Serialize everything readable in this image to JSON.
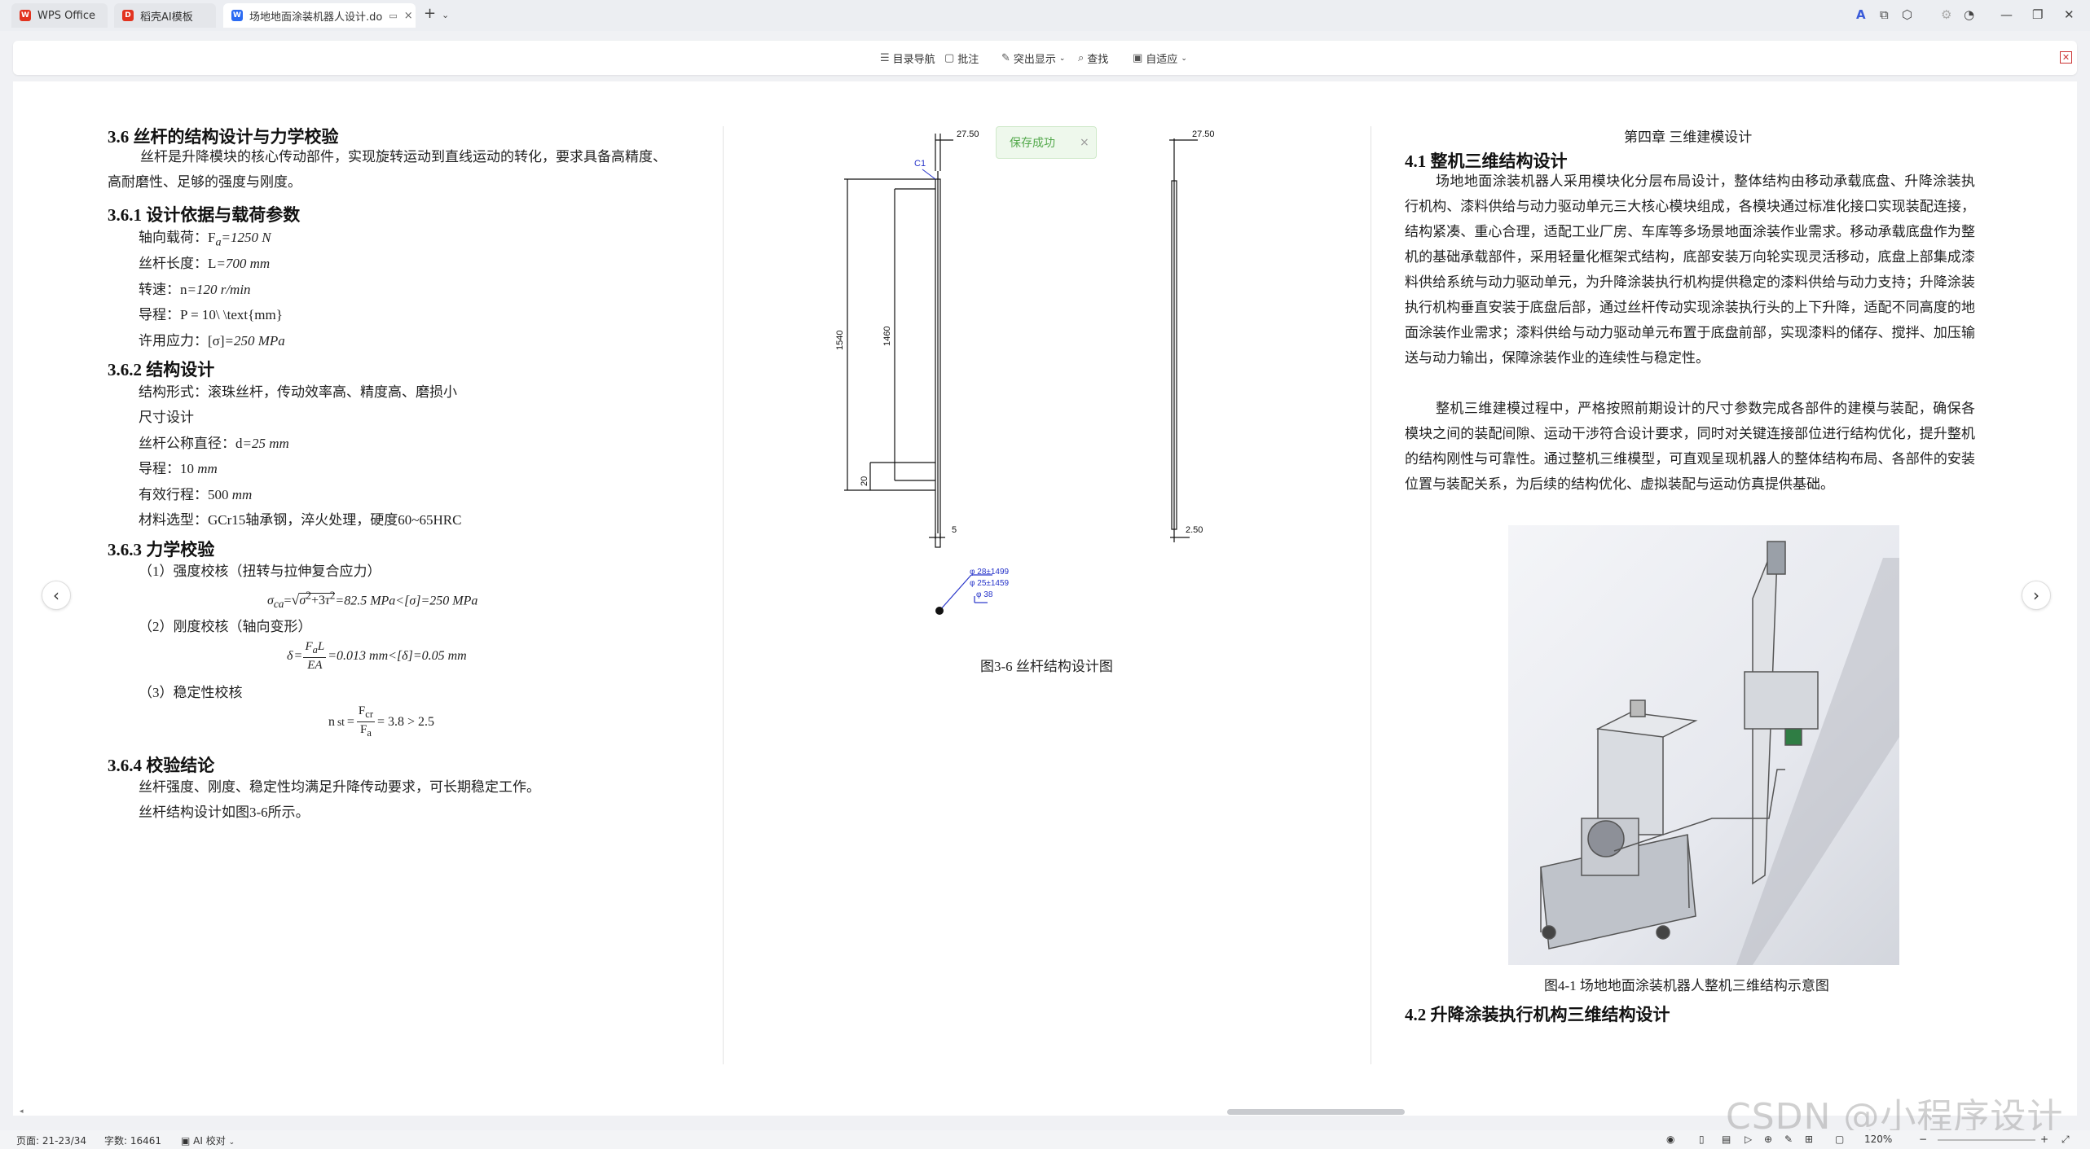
{
  "tabs": [
    {
      "label": "WPS Office",
      "icon": "wps-icon",
      "color": "#e2331f"
    },
    {
      "label": "稻壳AI模板",
      "icon": "docer-icon",
      "color": "#e2331f"
    },
    {
      "label": "场地地面涂装机器人设计.do",
      "icon": "writer-icon",
      "color": "#2b6bf3"
    }
  ],
  "toolbar": {
    "toc": "目录导航",
    "comment": "批注",
    "highlight": "突出显示",
    "find": "查找",
    "fit": "自适应"
  },
  "toast": {
    "text": "保存成功",
    "close": "×"
  },
  "page1": {
    "h36": "3.6 丝杆的结构设计与力学校验",
    "intro": "丝杆是升降模块的核心传动部件，实现旋转运动到直线运动的转化，要求具备高精度、高耐磨性、足够的强度与刚度。",
    "h361": "3.6.1 设计依据与载荷参数",
    "load": [
      "轴向载荷：F",
      "a",
      "=1250 N"
    ],
    "length": [
      "丝杆长度：L",
      "=700 mm"
    ],
    "speed": [
      "转速：n",
      "=120 r/min"
    ],
    "lead": "导程：P = 10\\ \\text{mm}",
    "stress": [
      "许用应力：[σ]",
      "=250 MPa"
    ],
    "h362": "3.6.2 结构设计",
    "form": "结构形式：滚珠丝杆，传动效率高、精度高、磨损小",
    "size": "尺寸设计",
    "dia": [
      "丝杆公称直径：d",
      "=25 mm"
    ],
    "lead2": [
      "导程：10 ",
      "mm"
    ],
    "stroke": [
      "有效行程：500 ",
      "mm"
    ],
    "material": "材料选型：GCr15轴承钢，淬火处理，硬度60~65HRC",
    "h363": "3.6.3 力学校验",
    "chk1": "（1）强度校核（扭转与拉伸复合应力）",
    "eq1": "=82.5 MPa<[σ]=250 MPa",
    "chk2": "（2）刚度校核（轴向变形）",
    "eq2": "=0.013 mm<[δ]=0.05 mm",
    "chk3": "（3）稳定性校核",
    "eq3": "= 3.8 > 2.5",
    "h364": "3.6.4 校验结论",
    "concl": "丝杆强度、刚度、稳定性均满足升降传动要求，可长期稳定工作。",
    "ref": "丝杆结构设计如图3-6所示。"
  },
  "page2": {
    "dims": {
      "d1": "27.50",
      "d2": "27.50",
      "c1": "C1",
      "l1540": "1540",
      "l1460": "1460",
      "l20": "20",
      "five": "5",
      "d250": "2.50",
      "dl1": "φ 28±1499",
      "dl2": "φ 25±1459",
      "dl3": "φ 38"
    },
    "caption": "图3-6 丝杆结构设计图"
  },
  "page3": {
    "chapter": "第四章 三维建模设计",
    "h41": "4.1 整机三维结构设计",
    "p1": "场地地面涂装机器人采用模块化分层布局设计，整体结构由移动承载底盘、升降涂装执行机构、漆料供给与动力驱动单元三大核心模块组成，各模块通过标准化接口实现装配连接，结构紧凑、重心合理，适配工业厂房、车库等多场景地面涂装作业需求。移动承载底盘作为整机的基础承载部件，采用轻量化框架式结构，底部安装万向轮实现灵活移动，底盘上部集成漆料供给系统与动力驱动单元，为升降涂装执行机构提供稳定的漆料供给与动力支持；升降涂装执行机构垂直安装于底盘后部，通过丝杆传动实现涂装执行头的上下升降，适配不同高度的地面涂装作业需求；漆料供给与动力驱动单元布置于底盘前部，实现漆料的储存、搅拌、加压输送与动力输出，保障涂装作业的连续性与稳定性。",
    "p2": "整机三维建模过程中，严格按照前期设计的尺寸参数完成各部件的建模与装配，确保各模块之间的装配间隙、运动干涉符合设计要求，同时对关键连接部位进行结构优化，提升整机的结构刚性与可靠性。通过整机三维模型，可直观呈现机器人的整体结构布局、各部件的安装位置与装配关系，为后续的结构优化、虚拟装配与运动仿真提供基础。",
    "caption": "图4-1 场地地面涂装机器人整机三维结构示意图",
    "h42": "4.2 升降涂装执行机构三维结构设计"
  },
  "status": {
    "page": "页面: 21-23/34",
    "words": "字数: 16461",
    "ai": "AI 校对",
    "zoom": "120%"
  },
  "watermark": "CSDN @小程序设计"
}
